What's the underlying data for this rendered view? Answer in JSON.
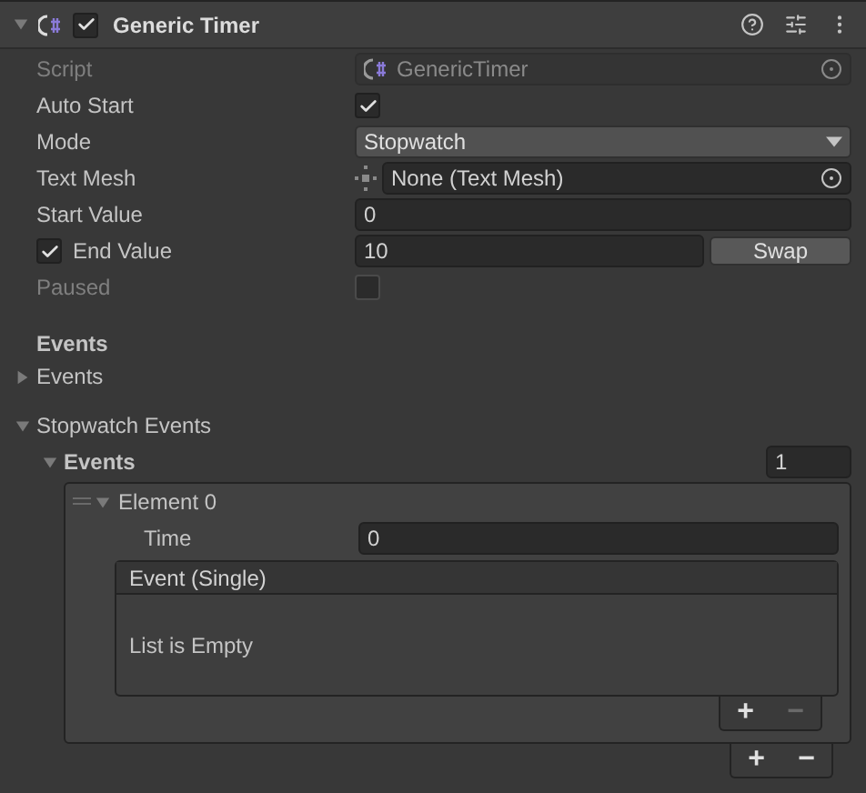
{
  "component": {
    "title": "Generic Timer",
    "enabled": true,
    "expanded": true
  },
  "fields": [
    {
      "kind": "object",
      "label": "Script",
      "value": "GenericTimer",
      "disabled": true
    },
    {
      "kind": "checkbox",
      "label": "Auto Start",
      "checked": true,
      "disabled": false
    },
    {
      "kind": "dropdown",
      "label": "Mode",
      "value": "Stopwatch",
      "disabled": false
    },
    {
      "kind": "object_empty",
      "label": "Text Mesh",
      "value": "None (Text Mesh)",
      "disabled": false
    },
    {
      "kind": "number",
      "label": "Start Value",
      "value": "0",
      "disabled": false
    },
    {
      "kind": "toggle_number",
      "label": "End Value",
      "checked": true,
      "value": "10",
      "button": "Swap",
      "disabled": false
    },
    {
      "kind": "checkbox",
      "label": "Paused",
      "checked": false,
      "disabled": true
    }
  ],
  "events_section": {
    "title": "Events",
    "foldout": {
      "label": "Events",
      "expanded": false
    }
  },
  "stopwatch_events": {
    "label": "Stopwatch Events",
    "expanded": true,
    "list": {
      "label": "Events",
      "expanded": true,
      "size": "1",
      "add": "+",
      "remove": "−",
      "remove_enabled": true,
      "elements": [
        {
          "label": "Element 0",
          "expanded": true,
          "time_label": "Time",
          "time": "0",
          "event": {
            "title": "Event (Single)",
            "empty_text": "List is Empty",
            "add": "+",
            "remove": "−",
            "remove_enabled": false
          }
        }
      ]
    }
  }
}
